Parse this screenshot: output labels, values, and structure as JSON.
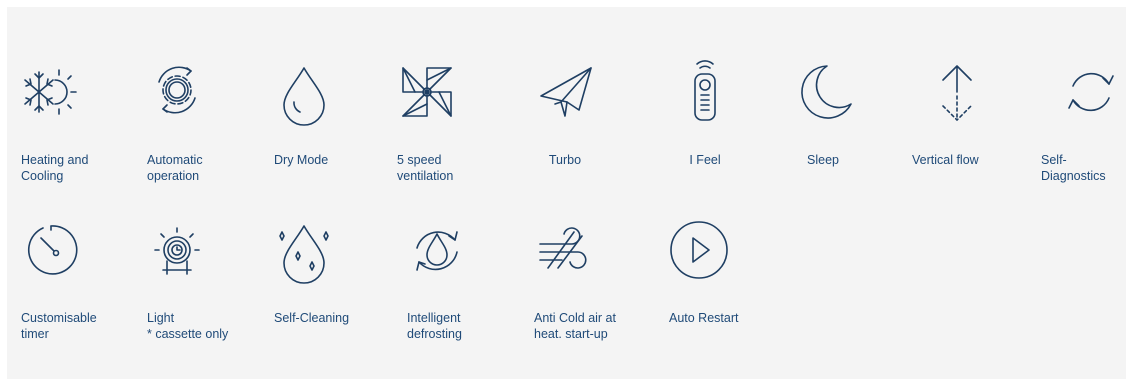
{
  "features_row1": [
    {
      "label": "Heating and\nCooling",
      "icon": "snowflake-sun-icon"
    },
    {
      "label": "Automatic\noperation",
      "icon": "auto-gear-icon"
    },
    {
      "label": "Dry Mode",
      "icon": "droplet-icon"
    },
    {
      "label": "5 speed\nventilation",
      "icon": "pinwheel-fan-icon"
    },
    {
      "label": "Turbo",
      "icon": "paper-plane-icon"
    },
    {
      "label": "I Feel",
      "icon": "remote-control-icon"
    },
    {
      "label": "Sleep",
      "icon": "moon-icon"
    },
    {
      "label": "Vertical flow",
      "icon": "vertical-flow-arrow-icon"
    },
    {
      "label": "Self-\nDiagnostics",
      "icon": "refresh-cycle-icon"
    }
  ],
  "features_row2": [
    {
      "label": "Customisable\ntimer",
      "icon": "timer-icon"
    },
    {
      "label": "Light\n* cassette only",
      "icon": "light-clock-icon"
    },
    {
      "label": "Self-Cleaning",
      "icon": "sparkling-droplet-icon"
    },
    {
      "label": "Intelligent\ndefrosting",
      "icon": "defrost-cycle-icon"
    },
    {
      "label": "Anti Cold air at\nheat. start-up",
      "icon": "warm-air-flow-icon"
    },
    {
      "label": "Auto Restart",
      "icon": "play-circle-icon"
    }
  ],
  "colors": {
    "panel_background": "#f4f4f4",
    "icon_stroke": "#1f3f63",
    "label_text": "#1f4a78"
  }
}
